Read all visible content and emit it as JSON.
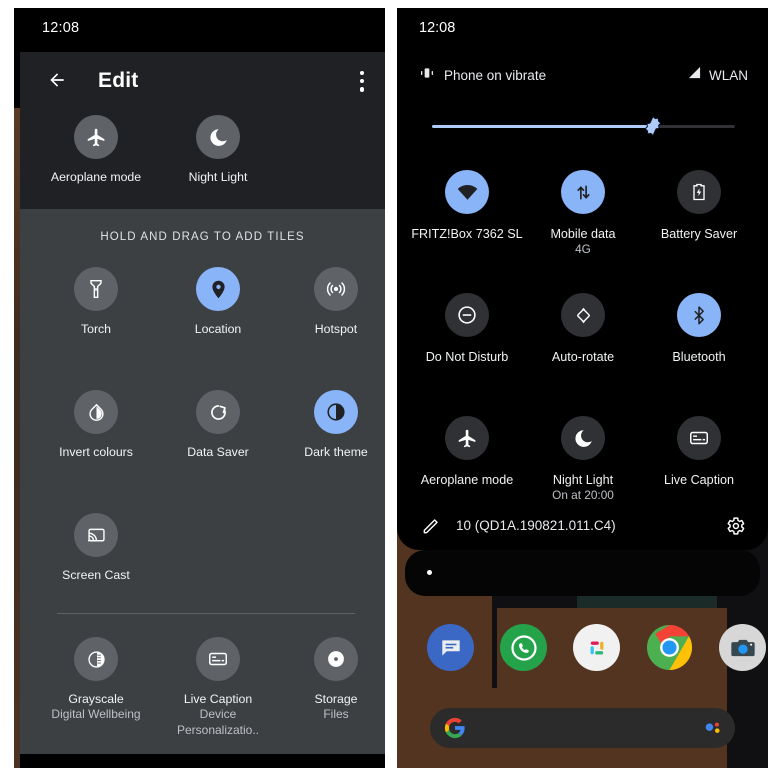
{
  "left_phone": {
    "status_bar": {
      "clock": "12:08"
    },
    "appbar": {
      "title": "Edit",
      "back_icon": "arrow-back-icon",
      "overflow_icon": "more-vert-icon"
    },
    "active_tiles": [
      {
        "label": "Aeroplane mode",
        "icon": "airplane-icon",
        "state": "off"
      },
      {
        "label": "Night Light",
        "icon": "moon-icon",
        "state": "off"
      }
    ],
    "hold_banner": "HOLD AND DRAG TO ADD TILES",
    "available_tiles": [
      {
        "label": "Torch",
        "sub": "",
        "icon": "flashlight-icon",
        "state": "off"
      },
      {
        "label": "Location",
        "sub": "",
        "icon": "location-pin-icon",
        "state": "on"
      },
      {
        "label": "Hotspot",
        "sub": "",
        "icon": "hotspot-icon",
        "state": "off"
      },
      {
        "label": "Invert colours",
        "sub": "",
        "icon": "invert-colors-icon",
        "state": "off"
      },
      {
        "label": "Data Saver",
        "sub": "",
        "icon": "data-saver-icon",
        "state": "off"
      },
      {
        "label": "Dark theme",
        "sub": "",
        "icon": "dark-theme-icon",
        "state": "on"
      },
      {
        "label": "Screen Cast",
        "sub": "",
        "icon": "screen-cast-icon",
        "state": "off"
      }
    ],
    "app_tiles": [
      {
        "label": "Grayscale",
        "sub": "Digital Wellbeing",
        "icon": "grayscale-icon",
        "state": "off"
      },
      {
        "label": "Live Caption",
        "sub": "Device Personalizatio..",
        "icon": "live-caption-icon",
        "state": "off"
      },
      {
        "label": "Storage",
        "sub": "Files",
        "icon": "storage-icon",
        "state": "off"
      }
    ]
  },
  "right_phone": {
    "status_bar": {
      "clock": "12:08"
    },
    "quick_settings": {
      "vibrate_text": "Phone on vibrate",
      "vibrate_icon": "vibration-icon",
      "network_text": "WLAN",
      "network_icon": "signal-icon",
      "brightness": {
        "icon": "brightness-thumb-icon",
        "percent": 73
      },
      "tiles": [
        {
          "label": "FRITZ!Box 7362 SL",
          "sub": "",
          "icon": "wifi-icon",
          "state": "on"
        },
        {
          "label": "Mobile data",
          "sub": "4G",
          "icon": "mobile-data-icon",
          "state": "on"
        },
        {
          "label": "Battery Saver",
          "sub": "",
          "icon": "battery-saver-icon",
          "state": "off"
        },
        {
          "label": "Do Not Disturb",
          "sub": "",
          "icon": "do-not-disturb-icon",
          "state": "off"
        },
        {
          "label": "Auto-rotate",
          "sub": "",
          "icon": "auto-rotate-icon",
          "state": "off"
        },
        {
          "label": "Bluetooth",
          "sub": "",
          "icon": "bluetooth-icon",
          "state": "on"
        },
        {
          "label": "Aeroplane mode",
          "sub": "",
          "icon": "airplane-icon",
          "state": "off"
        },
        {
          "label": "Night Light",
          "sub": "On at 20:00",
          "icon": "moon-icon",
          "state": "off"
        },
        {
          "label": "Live Caption",
          "sub": "",
          "icon": "live-caption-icon",
          "state": "off"
        }
      ],
      "footer": {
        "edit_icon": "pencil-icon",
        "build_number": "10 (QD1A.190821.011.C4)",
        "settings_icon": "gear-icon"
      }
    },
    "home_screen": {
      "page_indicator": "page-dot",
      "dock": [
        {
          "name": "Messages",
          "icon": "messages-icon"
        },
        {
          "name": "WhatsApp",
          "icon": "whatsapp-icon"
        },
        {
          "name": "Slack",
          "icon": "slack-icon"
        },
        {
          "name": "Chrome",
          "icon": "chrome-icon"
        },
        {
          "name": "Camera",
          "icon": "camera-icon"
        }
      ],
      "search_bar": {
        "left_icon": "google-g-icon",
        "right_icon": "assistant-icon",
        "value": ""
      }
    }
  },
  "colors": {
    "accent_blue": "#8ab4f8",
    "panel_dark": "#202124",
    "panel_gray": "#3c4043",
    "tile_off": "#5f6368",
    "qs_tile_off": "#303134"
  }
}
